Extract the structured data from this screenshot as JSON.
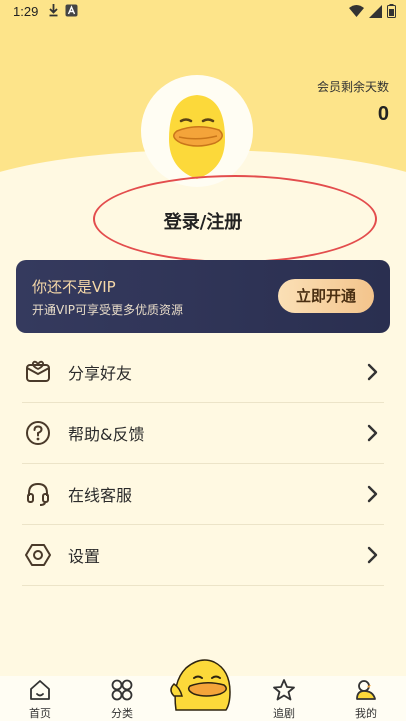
{
  "status_bar": {
    "time": "1:29"
  },
  "membership": {
    "days_label": "会员剩余天数",
    "days_value": "0"
  },
  "login": {
    "label": "登录/注册"
  },
  "vip": {
    "title": "你还不是VIP",
    "subtitle": "开通VIP可享受更多优质资源",
    "button": "立即开通"
  },
  "menu": {
    "items": [
      {
        "label": "分享好友",
        "icon": "share-envelope-icon"
      },
      {
        "label": "帮助&反馈",
        "icon": "help-question-icon"
      },
      {
        "label": "在线客服",
        "icon": "headset-icon"
      },
      {
        "label": "设置",
        "icon": "settings-hexagon-icon"
      }
    ]
  },
  "tabbar": {
    "tabs": [
      {
        "label": "首页",
        "icon": "home-icon"
      },
      {
        "label": "分类",
        "icon": "category-grid-icon"
      },
      {
        "label": "追剧",
        "icon": "star-icon"
      },
      {
        "label": "我的",
        "icon": "profile-duck-icon"
      }
    ]
  },
  "colors": {
    "header": "#fde48a",
    "background": "#fff9e2",
    "vip_card": "#353a5e",
    "vip_button": "#f3c48c",
    "highlight_oval": "#e34d4d"
  }
}
